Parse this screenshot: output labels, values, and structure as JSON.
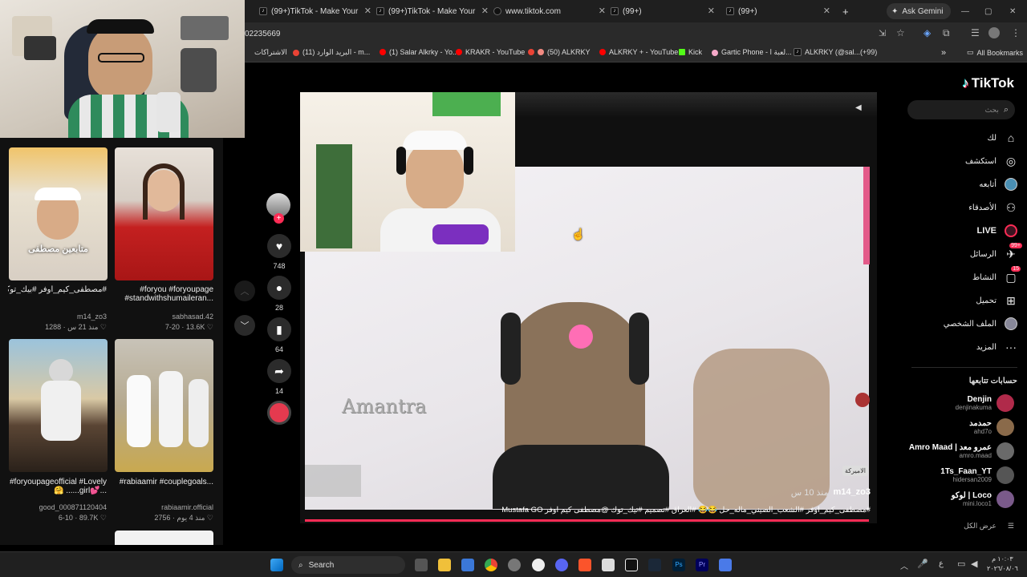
{
  "browser": {
    "tabs": [
      {
        "label": "(99+)TikTok - Make Your Day",
        "active": false
      },
      {
        "label": "(99+)TikTok - Make Your Day",
        "active": false
      },
      {
        "label": "www.tiktok.com",
        "active": false
      },
      {
        "label": "(99+)",
        "active": false
      },
      {
        "label": "(99+)",
        "active": false
      }
    ],
    "new_tab": "+",
    "ask_gemini": "Ask Gemini",
    "url_fragment": "02235669",
    "bookmarks": [
      {
        "label": "الاشتراكات"
      },
      {
        "label": "(11) البريد الوارد - m..."
      },
      {
        "label": "(1) Salar Alkrky - Yo..."
      },
      {
        "label": "KRAKR - YouTube"
      },
      {
        "label": "(50) ALKRKY"
      },
      {
        "label": "ALKRKY + - YouTube"
      },
      {
        "label": "Kick"
      },
      {
        "label": "Gartic Phone - لعبة ا..."
      },
      {
        "label": "ALKRKY (@sal...(+99)"
      }
    ],
    "all_bookmarks": "All Bookmarks"
  },
  "left_feed": {
    "cards": [
      {
        "overlay": "متابعين مصطفى",
        "caption": "#مصطفى_كيم_اوفر #بيك_توكـ... 😂😂😂😂",
        "user": "m14_zo3",
        "time": "منذ 21 س",
        "likes": "1288"
      },
      {
        "caption": "#foryou #foryoupage #standwithshumaileran...",
        "user": "sabhasad.42",
        "time": "7-20",
        "likes": "13.6K"
      },
      {
        "caption": "#foryoupageofficial #Lovely🤗 ......girl💕...",
        "user": "good_000871120404",
        "time": "6-10",
        "likes": "89.7K"
      },
      {
        "caption": "#rabiaamir #couplegoals...",
        "user": "rabiaamir.official",
        "time": "منذ 4 يوم",
        "likes": "2756"
      }
    ]
  },
  "actions": {
    "likes": "748",
    "comments": "28",
    "saves": "64",
    "shares": "14"
  },
  "video": {
    "author": "m14_zo3",
    "time": "منذ 10 س",
    "caption": "#مصطفى_كيم_اوفر #الشعب_الصيني_ماله_حل 😂😂 #العراق #تصميم #تيك_توك @مصطفى كيم اوفر Mustafa GO",
    "watermark": "Amantra",
    "side_label": "الاميركة"
  },
  "sidebar": {
    "logo": "TikTok",
    "search_placeholder": "بحث",
    "nav": [
      {
        "label": "لك",
        "icon": "home-icon"
      },
      {
        "label": "استكشف",
        "icon": "compass-icon"
      },
      {
        "label": "أتابعه",
        "icon": "following-icon"
      },
      {
        "label": "الأصدقاء",
        "icon": "friends-icon"
      },
      {
        "label": "LIVE",
        "icon": "live-icon"
      },
      {
        "label": "الرسائل",
        "icon": "messages-icon",
        "badge": "99+"
      },
      {
        "label": "النشاط",
        "icon": "activity-icon",
        "badge": "15"
      },
      {
        "label": "تحميل",
        "icon": "upload-icon"
      },
      {
        "label": "الملف الشخصي",
        "icon": "profile-icon"
      },
      {
        "label": "المزيد",
        "icon": "more-icon"
      }
    ],
    "following_title": "حسابات تتابعها",
    "accounts": [
      {
        "name": "Denjin",
        "handle": "denjinakuma"
      },
      {
        "name": "حمدمد",
        "handle": "ahd7o"
      },
      {
        "name": "Amro Maad | عمرو معد",
        "handle": "amro.maad"
      },
      {
        "name": "1Ts_Faan_YT",
        "handle": "hidersan2009"
      },
      {
        "name": "لوكو | Loco",
        "handle": "mini.loco1"
      }
    ],
    "see_all": "عرض الكل"
  },
  "taskbar": {
    "search": "Search",
    "clock_time": "١٠:٠٣ م",
    "clock_date": "٢٠٢٦/٠٨/٠٦",
    "lang": "ع"
  },
  "colors": {
    "tiktok_red": "#fe2c55",
    "tiktok_cyan": "#25f4ee"
  }
}
